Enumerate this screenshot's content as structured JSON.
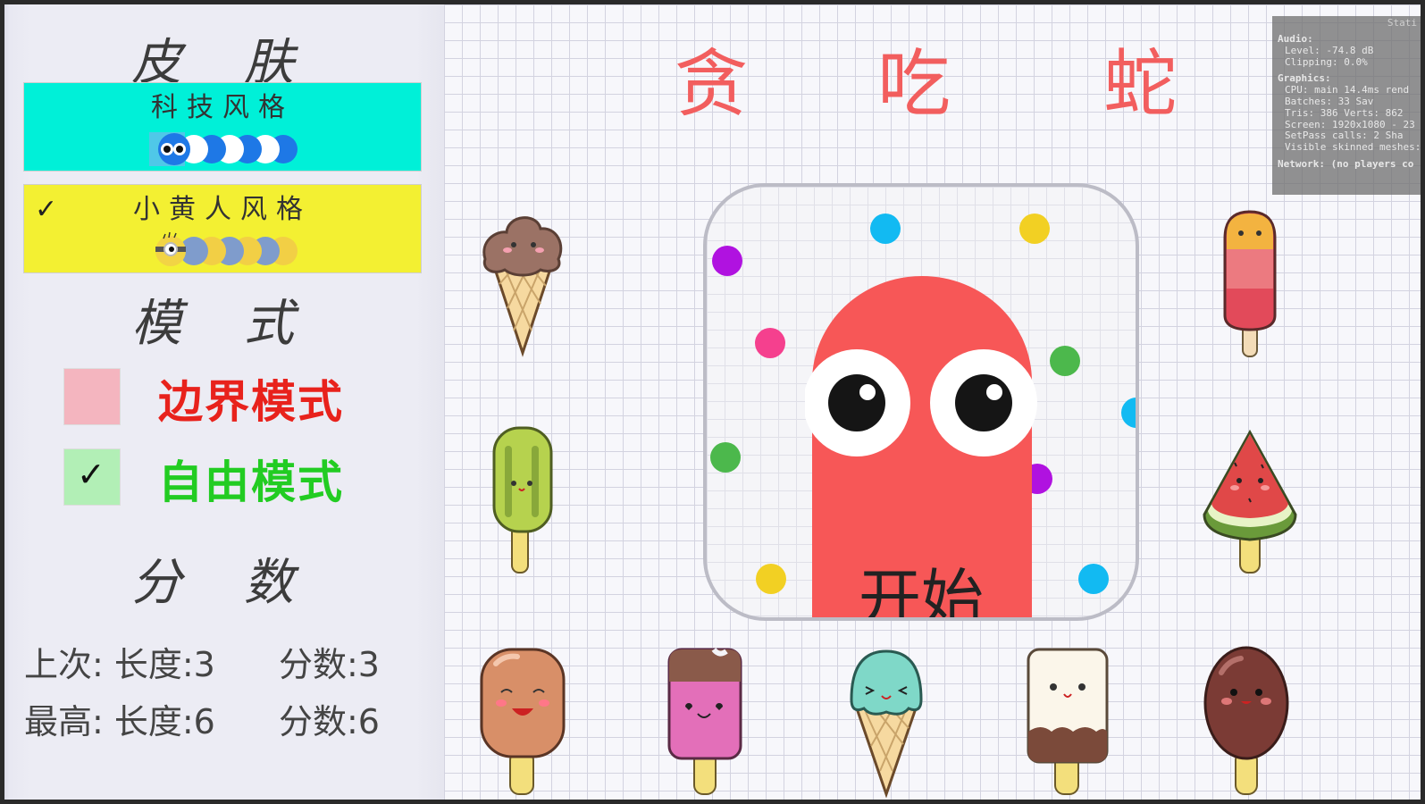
{
  "skins_section": {
    "title": "皮 肤",
    "tech_style": {
      "label": "科技风格",
      "color": "#00f0d8"
    },
    "minion_style": {
      "label": "小黄人风格",
      "color": "#f3f032",
      "selected_mark": "✓"
    }
  },
  "mode_section": {
    "title": "模 式",
    "border_mode": {
      "label": "边界模式",
      "color": "#e8221c",
      "checked": false
    },
    "free_mode": {
      "label": "自由模式",
      "color": "#22cc22",
      "checked": true,
      "check_mark": "✓"
    }
  },
  "score_section": {
    "title": "分 数",
    "last": {
      "length_label": "上次: 长度:3",
      "score_label": "分数:3"
    },
    "best": {
      "length_label": "最高: 长度:6",
      "score_label": "分数:6"
    }
  },
  "game_title": [
    "贪",
    "吃",
    "蛇"
  ],
  "start_button": {
    "label": "开始",
    "snake_color": "#f75757"
  },
  "stats_overlay": {
    "corner_label": "Stati",
    "lines": [
      "Audio:",
      "  Level: -74.8 dB",
      "  Clipping: 0.0%",
      "Graphics:",
      "  CPU: main 14.4ms  rend",
      "  Batches: 33        Sav",
      "  Tris: 386  Verts: 862",
      "  Screen: 1920x1080 - 23",
      "  SetPass calls: 2    Sha",
      "  Visible skinned meshes:",
      "Network: (no players co"
    ]
  }
}
